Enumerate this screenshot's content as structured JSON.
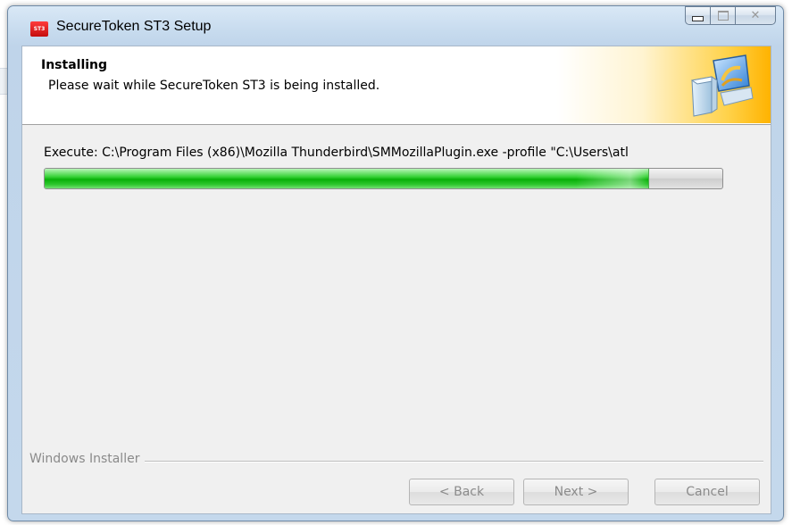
{
  "window": {
    "title": "SecureToken ST3 Setup",
    "icon_label": "ST3",
    "caption_buttons": [
      "minimize",
      "maximize",
      "close"
    ]
  },
  "header": {
    "title": "Installing",
    "subtitle": "Please wait while SecureToken ST3 is being installed."
  },
  "status": {
    "execute_text": "Execute: C:\\Program Files (x86)\\Mozilla Thunderbird\\SMMozillaPlugin.exe -profile \"C:\\Users\\atl"
  },
  "progress": {
    "percent": 89,
    "color": "#1fbf1f"
  },
  "footer": {
    "label": "Windows Installer"
  },
  "buttons": {
    "back": "< Back",
    "next": "Next >",
    "cancel": "Cancel"
  },
  "colors": {
    "accent_orange": "#ffb300",
    "frame_blue": "#c7dbee",
    "disabled_text": "#8b8b8b"
  },
  "icons": {
    "app": "st3-app-icon",
    "header": "installer-box-icon",
    "close": "close-icon",
    "minimize": "minimize-icon",
    "maximize": "maximize-icon"
  }
}
